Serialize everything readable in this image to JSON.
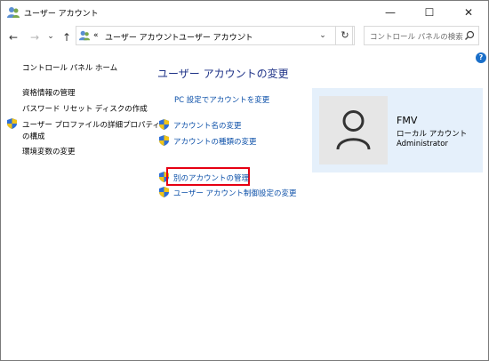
{
  "window": {
    "title": "ユーザー アカウント",
    "controls": {
      "minimize": "—",
      "maximize": "☐",
      "close": "✕"
    }
  },
  "navbar": {
    "back": "←",
    "forward": "→",
    "history": "⌄",
    "up": "↑",
    "address_prefix": "«",
    "breadcrumbs": [
      "ユーザー アカウント",
      "ユーザー アカウント"
    ],
    "separator": "›",
    "refresh": "↻",
    "search_placeholder": "コントロール パネルの検索"
  },
  "help": "?",
  "sidebar": {
    "items": [
      {
        "label": "コントロール パネル ホーム"
      },
      {
        "label": "資格情報の管理"
      },
      {
        "label": "パスワード リセット ディスクの作成"
      },
      {
        "label": "ユーザー プロファイルの詳細プロパティ"
      },
      {
        "label": "の構成"
      },
      {
        "label": "環境変数の変更"
      }
    ]
  },
  "main": {
    "title": "ユーザー アカウントの変更",
    "links": [
      {
        "label": "PC 設定でアカウントを変更"
      },
      {
        "label": "アカウント名の変更"
      },
      {
        "label": "アカウントの種類の変更"
      },
      {
        "label": "別のアカウントの管理"
      },
      {
        "label": "ユーザー アカウント制御設定の変更"
      }
    ]
  },
  "account": {
    "name": "FMV",
    "type": "ローカル アカウント",
    "role": "Administrator"
  },
  "icons": {
    "title": "user-accounts-icon",
    "shield": "uac-shield-icon",
    "avatar": "user-avatar-icon"
  },
  "colors": {
    "link": "#0b4fa8",
    "heading": "#1e3287",
    "highlight": "#e60012",
    "card": "#e5f0fb"
  }
}
